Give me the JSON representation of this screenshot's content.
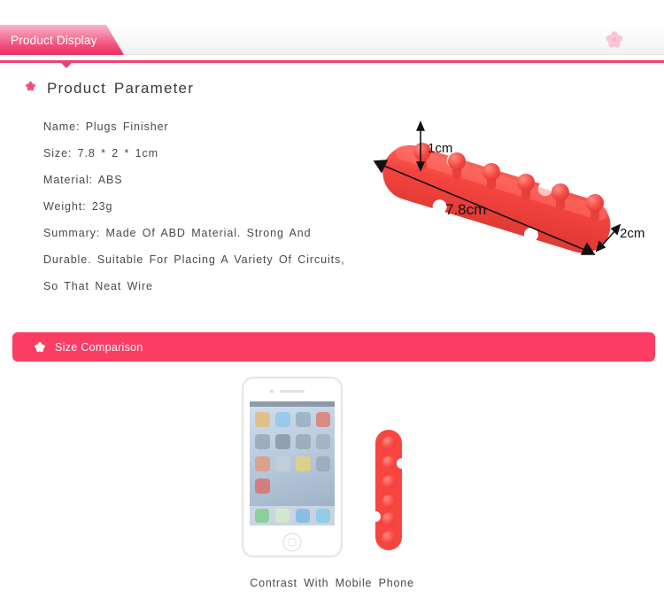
{
  "header": {
    "tab_label": "Product Display",
    "flower_icon": "flower-icon",
    "accent_color": "#ef4172",
    "tab_gradient_from": "#f9b4c7",
    "tab_gradient_to": "#ec2d60"
  },
  "parameter_section": {
    "bullet_icon": "flower-bullet-icon",
    "heading": "Product  Parameter",
    "specs": [
      "Name:  Plugs  Finisher",
      "Size:  7.8  *  2  *  1cm",
      "Material:  ABS",
      "Weight:  23g"
    ],
    "summary_lines": [
      "Summary:  Made  Of  ABD  Material.  Strong  And",
      "Durable.  Suitable  For  Placing  A  Variety  Of  Circuits,",
      "So  That  Neat  Wire"
    ]
  },
  "product_photo": {
    "name": "cable-clip-photo",
    "product_color": "#f4453f",
    "dimension_labels": {
      "height": "1cm",
      "length": "7.8cm",
      "depth": "2cm"
    }
  },
  "comparison_section": {
    "banner_label": "Size Comparison",
    "banner_color": "#fb3d63",
    "banner_flower_icon": "flower-icon",
    "phone_name": "white-smartphone",
    "clip_name": "cable-clip-vertical",
    "clip_color": "#f4453f",
    "caption": "Contrast  With  Mobile  Phone"
  }
}
